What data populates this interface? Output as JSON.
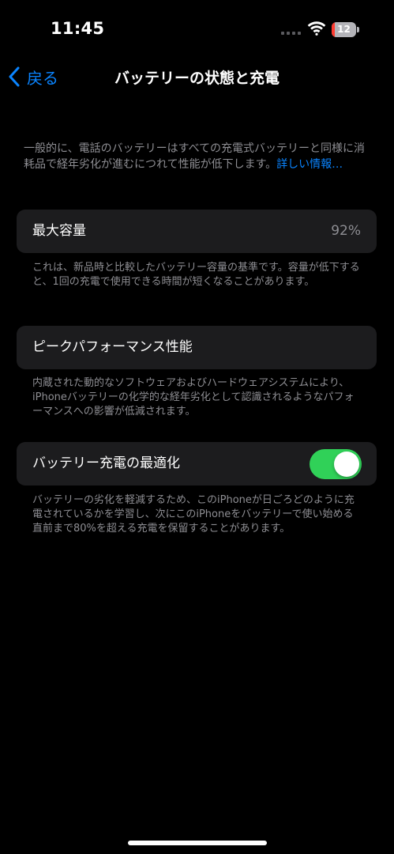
{
  "status_bar": {
    "time": "11:45",
    "battery_level": "12",
    "battery_fraction": 0.12,
    "battery_color": "#ff3b30",
    "icons": [
      "signal-icon",
      "wifi-icon",
      "battery-icon"
    ]
  },
  "nav": {
    "back_label": "戻る",
    "back_icon": "chevron-left-icon",
    "title": "バッテリーの状態と充電"
  },
  "intro": {
    "text": "一般的に、電話のバッテリーはすべての充電式バッテリーと同様に消耗品で経年劣化が進むにつれて性能が低下します。",
    "link": "詳しい情報…"
  },
  "max_capacity": {
    "label": "最大容量",
    "value": "92%",
    "footnote": "これは、新品時と比較したバッテリー容量の基準です。容量が低下すると、1回の充電で使用できる時間が短くなることがあります。"
  },
  "peak_performance": {
    "label": "ピークパフォーマンス性能",
    "footnote": "内蔵された動的なソフトウェアおよびハードウェアシステムにより、iPhoneバッテリーの化学的な経年劣化として認識されるようなパフォーマンスへの影響が低減されます。"
  },
  "optimized_charging": {
    "label": "バッテリー充電の最適化",
    "enabled": true,
    "footnote": "バッテリーの劣化を軽減するため、このiPhoneが日ごろどのように充電されているかを学習し、次にこのiPhoneをバッテリーで使い始める直前まで80%を超える充電を保留することがあります。"
  },
  "colors": {
    "background": "#000000",
    "card": "#1c1c1e",
    "accent": "#0a84ff",
    "toggle_on": "#30d158",
    "secondary_text": "#8e8e93"
  }
}
